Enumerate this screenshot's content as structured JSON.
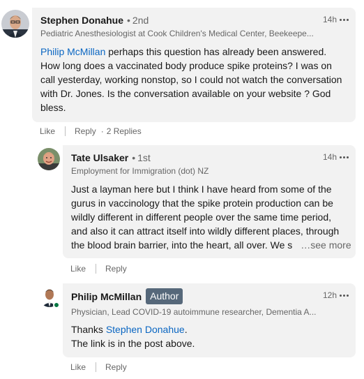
{
  "comments": [
    {
      "name": "Stephen Donahue",
      "separator": "•",
      "degree": "2nd",
      "headline": "Pediatric Anesthesiologist at Cook Children's Medical Center, Beekeepe...",
      "time": "14h",
      "mention": "Philip McMillan",
      "body_lines": [
        " perhaps this question has already been answered.",
        "How long does a vaccinated body produce spike proteins? I was on",
        "call yesterday, working nonstop, so I could not watch the conversation",
        "with Dr. Jones. Is the conversation available on your website ? God",
        "bless."
      ],
      "like_label": "Like",
      "reply_label": "Reply",
      "dot": "·",
      "replies_label": "2 Replies"
    },
    {
      "name": "Tate Ulsaker",
      "separator": "•",
      "degree": "1st",
      "headline": "Employment for Immigration (dot) NZ",
      "time": "14h",
      "body_lines": [
        "Just a layman here but I think I have heard from some of the",
        "gurus in vaccinology that the spike protein production can be",
        "wildly different in different people over the same time period,",
        "and also it can attract itself into wildly different places, through",
        "the blood brain barrier, into the heart, all over. We s"
      ],
      "see_more": "…see more",
      "like_label": "Like",
      "reply_label": "Reply"
    },
    {
      "name": "Philip McMillan",
      "badge": "Author",
      "headline": "Physician, Lead COVID-19 autoimmune researcher, Dementia A...",
      "time": "12h",
      "thanks": "Thanks ",
      "mention": "Stephen Donahue",
      "period": ".",
      "line2": "The link is in the post above.",
      "like_label": "Like",
      "reply_label": "Reply"
    }
  ],
  "colors": {
    "link": "#0a66c2",
    "bubble": "#f2f2f2",
    "badge": "#56687a",
    "online": "#057642"
  },
  "icons": [
    "more-options-icon",
    "online-status-icon"
  ]
}
